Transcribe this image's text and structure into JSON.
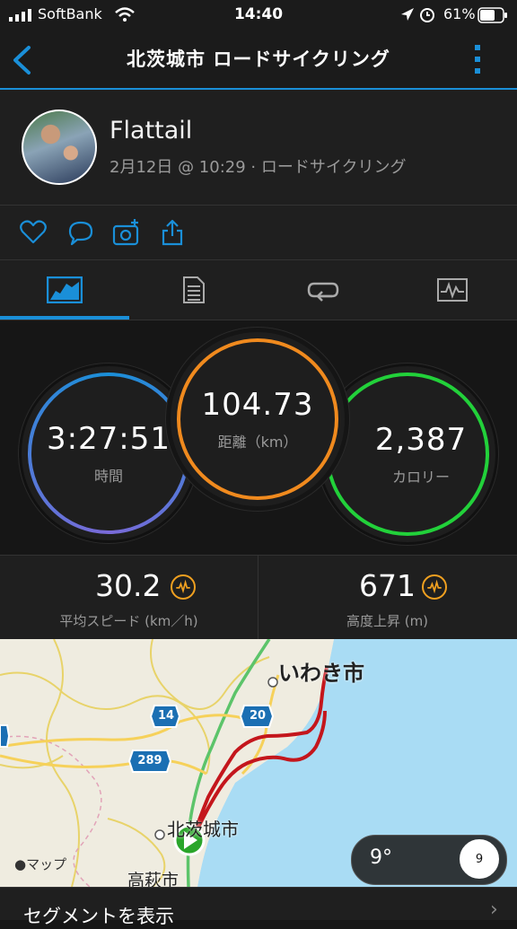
{
  "status_bar": {
    "carrier": "SoftBank",
    "time": "14:40",
    "battery": "61%"
  },
  "nav": {
    "title": "北茨城市 ロードサイクリング"
  },
  "profile": {
    "name": "Flattail",
    "meta": "2月12日 @ 10:29 · ロードサイクリング"
  },
  "stats": {
    "time": {
      "value": "3:27:51",
      "label": "時間"
    },
    "distance": {
      "value": "104.73",
      "label": "距離（km）"
    },
    "calories": {
      "value": "2,387",
      "label": "カロリー"
    }
  },
  "metrics": [
    {
      "value": "30.2",
      "label": "平均スピード (km／h)"
    },
    {
      "value": "671",
      "label": "高度上昇 (m)"
    }
  ],
  "map": {
    "labels": {
      "iwaki": "いわき市",
      "kitaibaraki": "北茨城市",
      "takahagi": "高萩市",
      "attribution": "マップ"
    },
    "routes": [
      "14",
      "20",
      "289"
    ],
    "weather": {
      "temp": "9°",
      "wind": "9"
    }
  },
  "segments": {
    "label": "セグメントを表示"
  },
  "colors": {
    "accent": "#1a8fd8",
    "time_ring": "#7a6ad8",
    "distance_ring": "#f08a1e",
    "calorie_ring": "#22d13a",
    "route": "#c4161c",
    "sea": "#a9dcf4"
  }
}
